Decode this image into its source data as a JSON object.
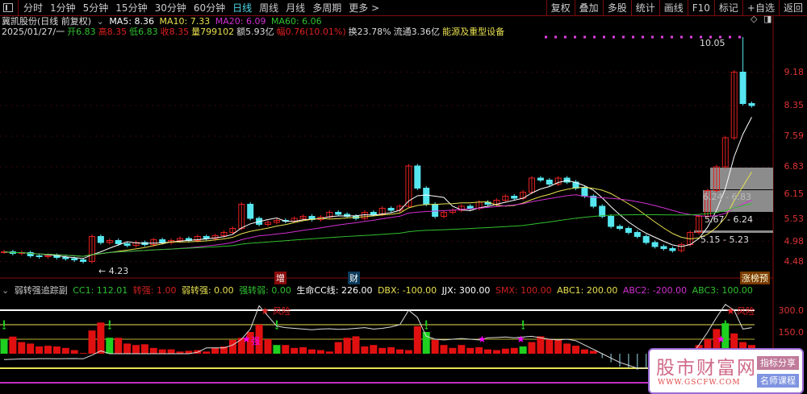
{
  "toolbar": {
    "periods": [
      "分时",
      "1分钟",
      "5分钟",
      "15分钟",
      "30分钟",
      "60分钟",
      "日线",
      "周线",
      "月线",
      "多周期",
      "更多 >"
    ],
    "active": "日线",
    "tools": [
      "复权",
      "叠加",
      "多股",
      "统计",
      "画线",
      "F10",
      "标记",
      "+自选",
      "返回"
    ]
  },
  "header": {
    "stock": "冀凯股份(日线 前复权)",
    "ma5": "MA5: 8.36",
    "ma10": "MA10: 7.33",
    "ma20": "MA20: 6.09",
    "ma60": "MA60: 6.06",
    "date": "2025/01/27/一",
    "open": "开6.83",
    "high": "高8.35",
    "low": "低6.83",
    "close": "收8.35",
    "vol": "量799102",
    "amount": "额5.93亿",
    "change": "幅0.76(10.01%)",
    "turnover": "换23.78%",
    "float": "流通3.36亿",
    "sector": "能源及重型设备"
  },
  "colors": {
    "up": "#e02020",
    "down": "#55e6f0",
    "ma5": "#ffffff",
    "ma10": "#e8e050",
    "ma20": "#d030d0",
    "ma60": "#30c030"
  },
  "price_axis": [
    "9.18",
    "8.35",
    "7.59",
    "6.83",
    "6.15",
    "5.53",
    "4.98",
    "4.48"
  ],
  "annotations": {
    "max": "10.05",
    "min": "4.23",
    "box1": "6.24 - 6.83",
    "box2": "5.67 - 6.24",
    "box3": "5.15 - 5.23",
    "tag_zeng": "增",
    "tag_cai": "财",
    "tag_rank": "涨榜预"
  },
  "indicator": {
    "name": "弱转强追踪副",
    "cc1": "CC1: 112.01",
    "zq": "转强: 1.00",
    "rzq": "弱转强: 0.00",
    "qzr": "强转弱: 0.00",
    "life": "生命CC线: 226.00",
    "dbx": "DBX: -100.00",
    "jjx": "JJX: 300.00",
    "smx": "SMX: 100.00",
    "abc1": "ABC1: 200.00",
    "abc2": "ABC2: -200.00",
    "abc3": "ABC3: 100.00",
    "axis": [
      "300.0",
      "150.0"
    ],
    "strong": "强",
    "risk": "风险"
  },
  "watermark": {
    "title": "股市财富网",
    "url": "WWW.GSCFW.COM",
    "b1": "指标分享",
    "b2": "名师课程"
  },
  "chart_data": {
    "type": "candlestick",
    "closes": [
      4.72,
      4.68,
      4.7,
      4.62,
      4.6,
      4.63,
      4.58,
      4.55,
      4.52,
      4.48,
      5.1,
      4.95,
      5.0,
      4.92,
      4.88,
      4.95,
      4.9,
      5.02,
      4.95,
      5.0,
      5.05,
      5.0,
      5.1,
      5.05,
      5.12,
      5.2,
      5.3,
      5.9,
      5.55,
      5.4,
      5.45,
      5.5,
      5.48,
      5.55,
      5.6,
      5.52,
      5.58,
      5.7,
      5.65,
      5.6,
      5.55,
      5.7,
      5.65,
      5.8,
      5.75,
      5.85,
      6.85,
      6.3,
      5.9,
      5.6,
      5.7,
      5.75,
      5.85,
      5.8,
      5.95,
      5.9,
      6.0,
      6.1,
      6.05,
      6.2,
      6.55,
      6.5,
      6.4,
      6.55,
      6.45,
      6.3,
      6.1,
      5.85,
      5.6,
      5.35,
      5.3,
      5.2,
      5.1,
      4.95,
      4.85,
      4.8,
      4.75,
      4.9,
      5.2,
      5.6,
      6.24,
      6.83,
      7.55,
      9.18,
      8.4,
      8.35
    ],
    "indicator_bars": [
      100,
      118,
      80,
      70,
      50,
      55,
      50,
      40,
      25,
      5,
      160,
      215,
      110,
      110,
      70,
      60,
      65,
      40,
      30,
      30,
      15,
      20,
      25,
      15,
      40,
      50,
      95,
      110,
      150,
      200,
      100,
      60,
      60,
      40,
      45,
      30,
      25,
      15,
      80,
      110,
      120,
      50,
      60,
      40,
      45,
      30,
      25,
      190,
      150,
      95,
      60,
      40,
      60,
      40,
      45,
      30,
      25,
      35,
      40,
      50,
      80,
      120,
      100,
      95,
      70,
      55,
      30,
      20,
      -30,
      -60,
      -90,
      -100,
      -110,
      -100,
      -80,
      -70,
      -40,
      -20,
      30,
      60,
      100,
      170,
      210,
      140,
      80,
      60
    ],
    "green_bars": [
      0,
      12,
      31,
      48,
      59,
      82
    ],
    "cc1": [
      -40,
      -38,
      -36,
      -36,
      -34,
      -34,
      -35,
      -34,
      -33,
      -35,
      -10,
      20,
      0,
      0,
      0,
      0,
      0,
      0,
      0,
      0,
      0,
      0,
      10,
      40,
      40,
      40,
      60,
      100,
      170,
      330,
      260,
      190,
      180,
      175,
      170,
      165,
      170,
      172,
      168,
      170,
      175,
      180,
      170,
      175,
      185,
      200,
      300,
      250,
      120,
      100,
      95,
      100,
      105,
      100,
      95,
      110,
      112,
      115,
      110,
      115,
      120,
      110,
      100,
      95,
      100,
      90,
      60,
      30,
      0,
      -30,
      -60,
      -80,
      -100,
      -100,
      -100,
      -100,
      -100,
      -80,
      -20,
      60,
      150,
      250,
      340,
      300,
      170,
      180
    ]
  }
}
